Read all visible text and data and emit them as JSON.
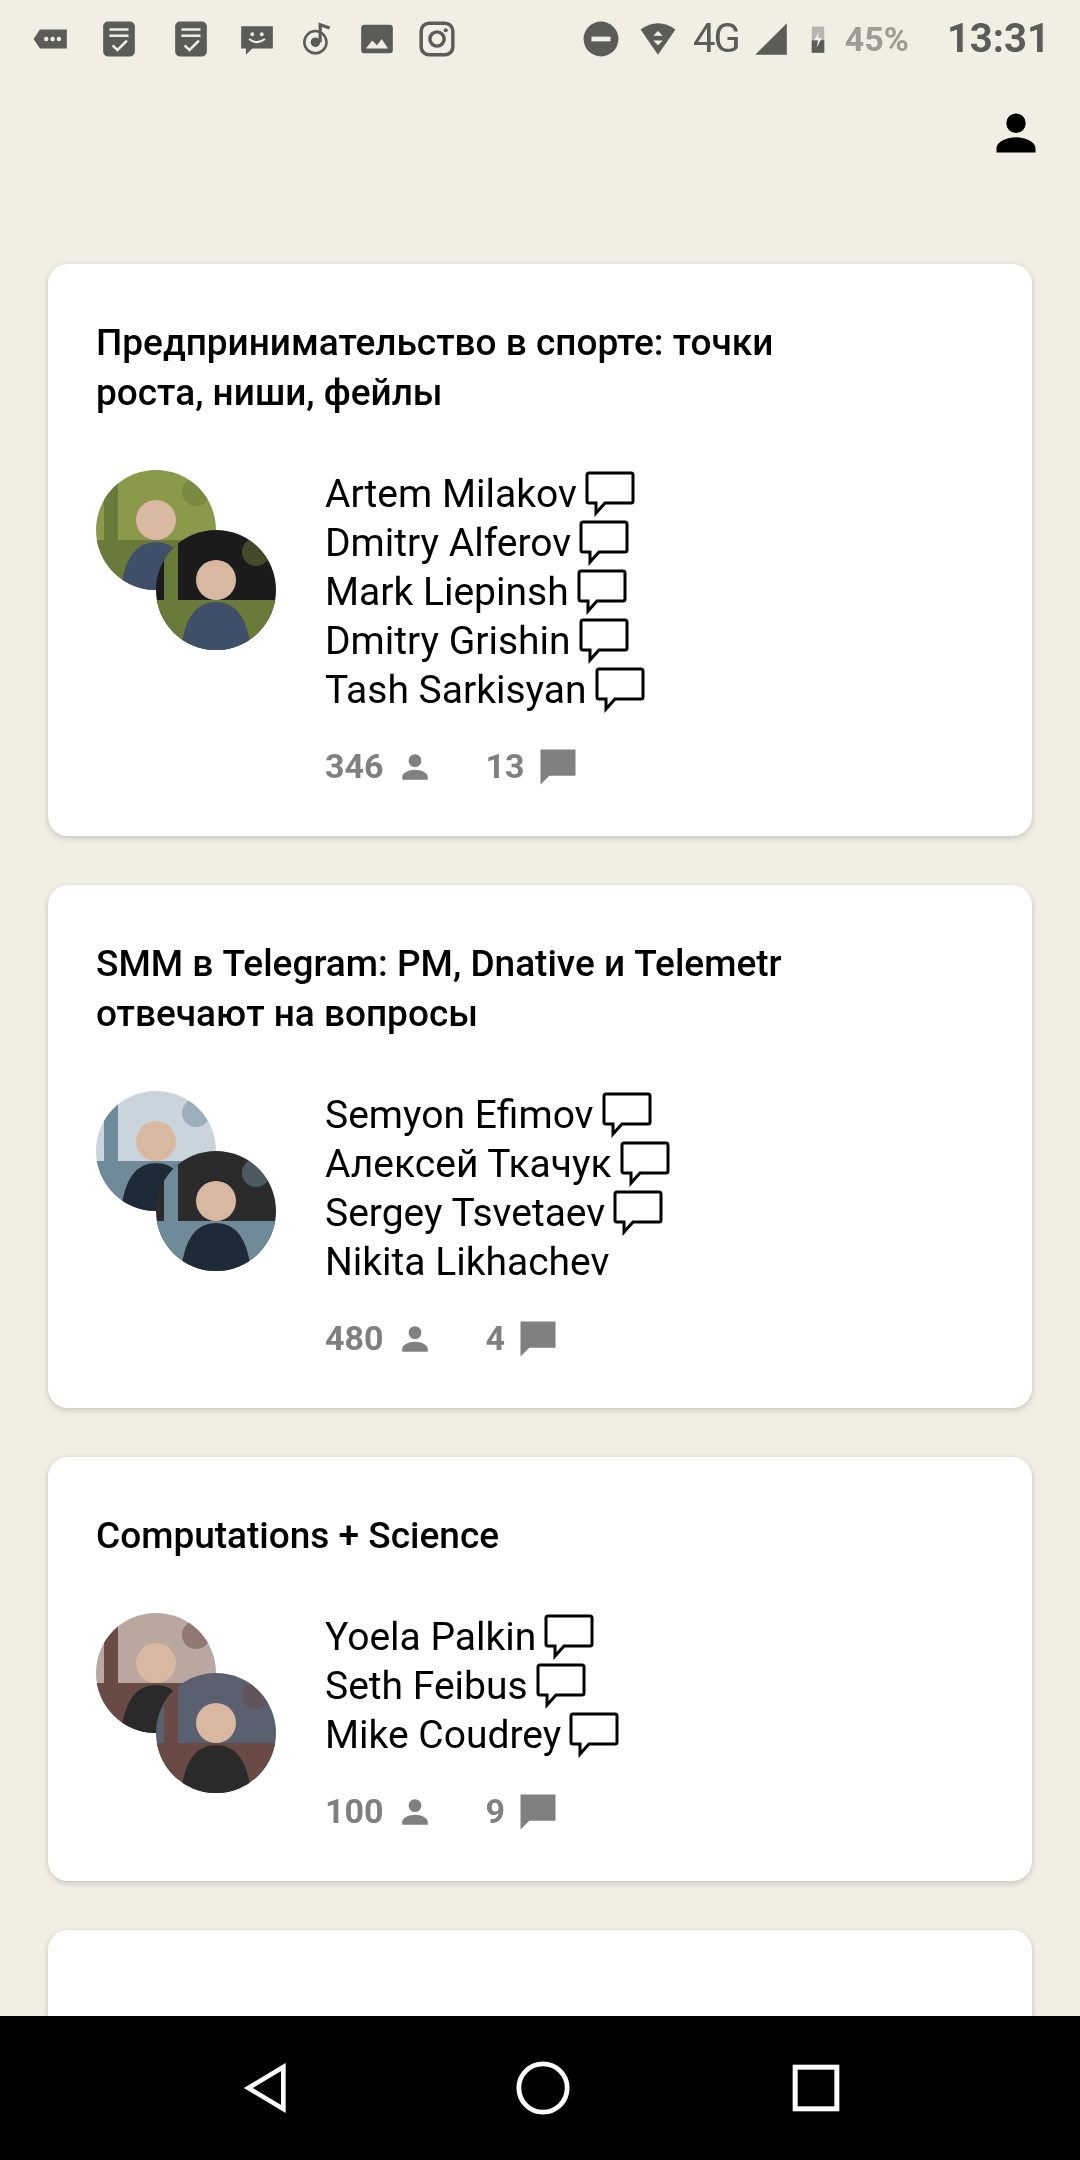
{
  "status_bar": {
    "battery": "45%",
    "time": "13:31",
    "network": "4G"
  },
  "cards": [
    {
      "title": "Предпринимательство в спорте: точки роста, ниши, фейлы",
      "speakers": [
        {
          "name": "Artem Milakov",
          "speaker_icon": true
        },
        {
          "name": "Dmitry Alferov",
          "speaker_icon": true
        },
        {
          "name": "Mark Liepinsh",
          "speaker_icon": true
        },
        {
          "name": "Dmitry Grishin",
          "speaker_icon": true
        },
        {
          "name": "Tash Sarkisyan",
          "speaker_icon": true
        }
      ],
      "listeners": "346",
      "messages": "13"
    },
    {
      "title": "SMM в Telegram: PM, Dnative и Telemetr отвечают на вопросы",
      "speakers": [
        {
          "name": "Semyon Efimov",
          "speaker_icon": true
        },
        {
          "name": "Алексей Ткачук",
          "speaker_icon": true
        },
        {
          "name": "Sergey Tsvetaev",
          "speaker_icon": true
        },
        {
          "name": "Nikita Likhachev",
          "speaker_icon": false
        }
      ],
      "listeners": "480",
      "messages": "4"
    },
    {
      "title": "Computations + Science",
      "speakers": [
        {
          "name": "Yoela Palkin",
          "speaker_icon": true
        },
        {
          "name": "Seth Feibus",
          "speaker_icon": true
        },
        {
          "name": "Mike Coudrey",
          "speaker_icon": true
        }
      ],
      "listeners": "100",
      "messages": "9"
    },
    {
      "partial": true
    }
  ]
}
